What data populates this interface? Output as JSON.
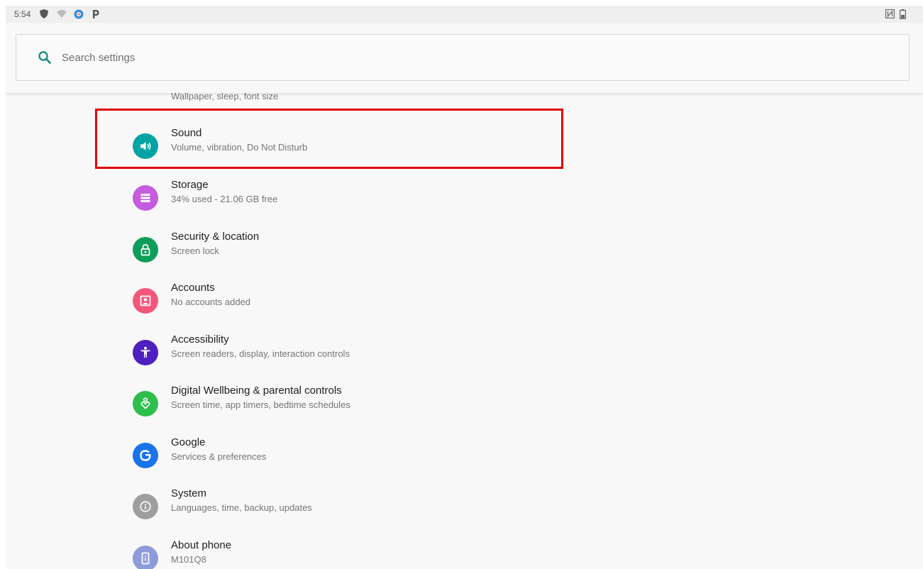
{
  "status_bar": {
    "time": "5:54",
    "left_icons": [
      "shield-icon",
      "wifi-icon",
      "app-notification-icon",
      "parking-icon"
    ],
    "right_icons": [
      "nfc-icon",
      "battery-icon"
    ]
  },
  "search": {
    "placeholder": "Search settings",
    "value": ""
  },
  "partial_item": {
    "subtitle": "Wallpaper, sleep, font size",
    "icon": "display-icon",
    "color": "#F4A43A"
  },
  "highlight": {
    "color": "#E00000",
    "target": "Sound"
  },
  "settings_items": [
    {
      "title": "Sound",
      "subtitle": "Volume, vibration, Do Not Disturb",
      "icon": "sound-icon",
      "color": "#00A3A3"
    },
    {
      "title": "Storage",
      "subtitle": "34% used - 21.06 GB free",
      "icon": "storage-icon",
      "color": "#C55BDE"
    },
    {
      "title": "Security & location",
      "subtitle": "Screen lock",
      "icon": "lock-icon",
      "color": "#0E9D58"
    },
    {
      "title": "Accounts",
      "subtitle": "No accounts added",
      "icon": "account-icon",
      "color": "#F2577B"
    },
    {
      "title": "Accessibility",
      "subtitle": "Screen readers, display, interaction controls",
      "icon": "accessibility-icon",
      "color": "#4F1FBF"
    },
    {
      "title": "Digital Wellbeing & parental controls",
      "subtitle": "Screen time, app timers, bedtime schedules",
      "icon": "wellbeing-icon",
      "color": "#2EBE4C"
    },
    {
      "title": "Google",
      "subtitle": "Services & preferences",
      "icon": "google-icon",
      "color": "#1A73E8"
    },
    {
      "title": "System",
      "subtitle": "Languages, time, backup, updates",
      "icon": "system-info-icon",
      "color": "#9E9E9E"
    },
    {
      "title": "About phone",
      "subtitle": "M101Q8",
      "icon": "phone-icon",
      "color": "#8E9BDB"
    }
  ]
}
